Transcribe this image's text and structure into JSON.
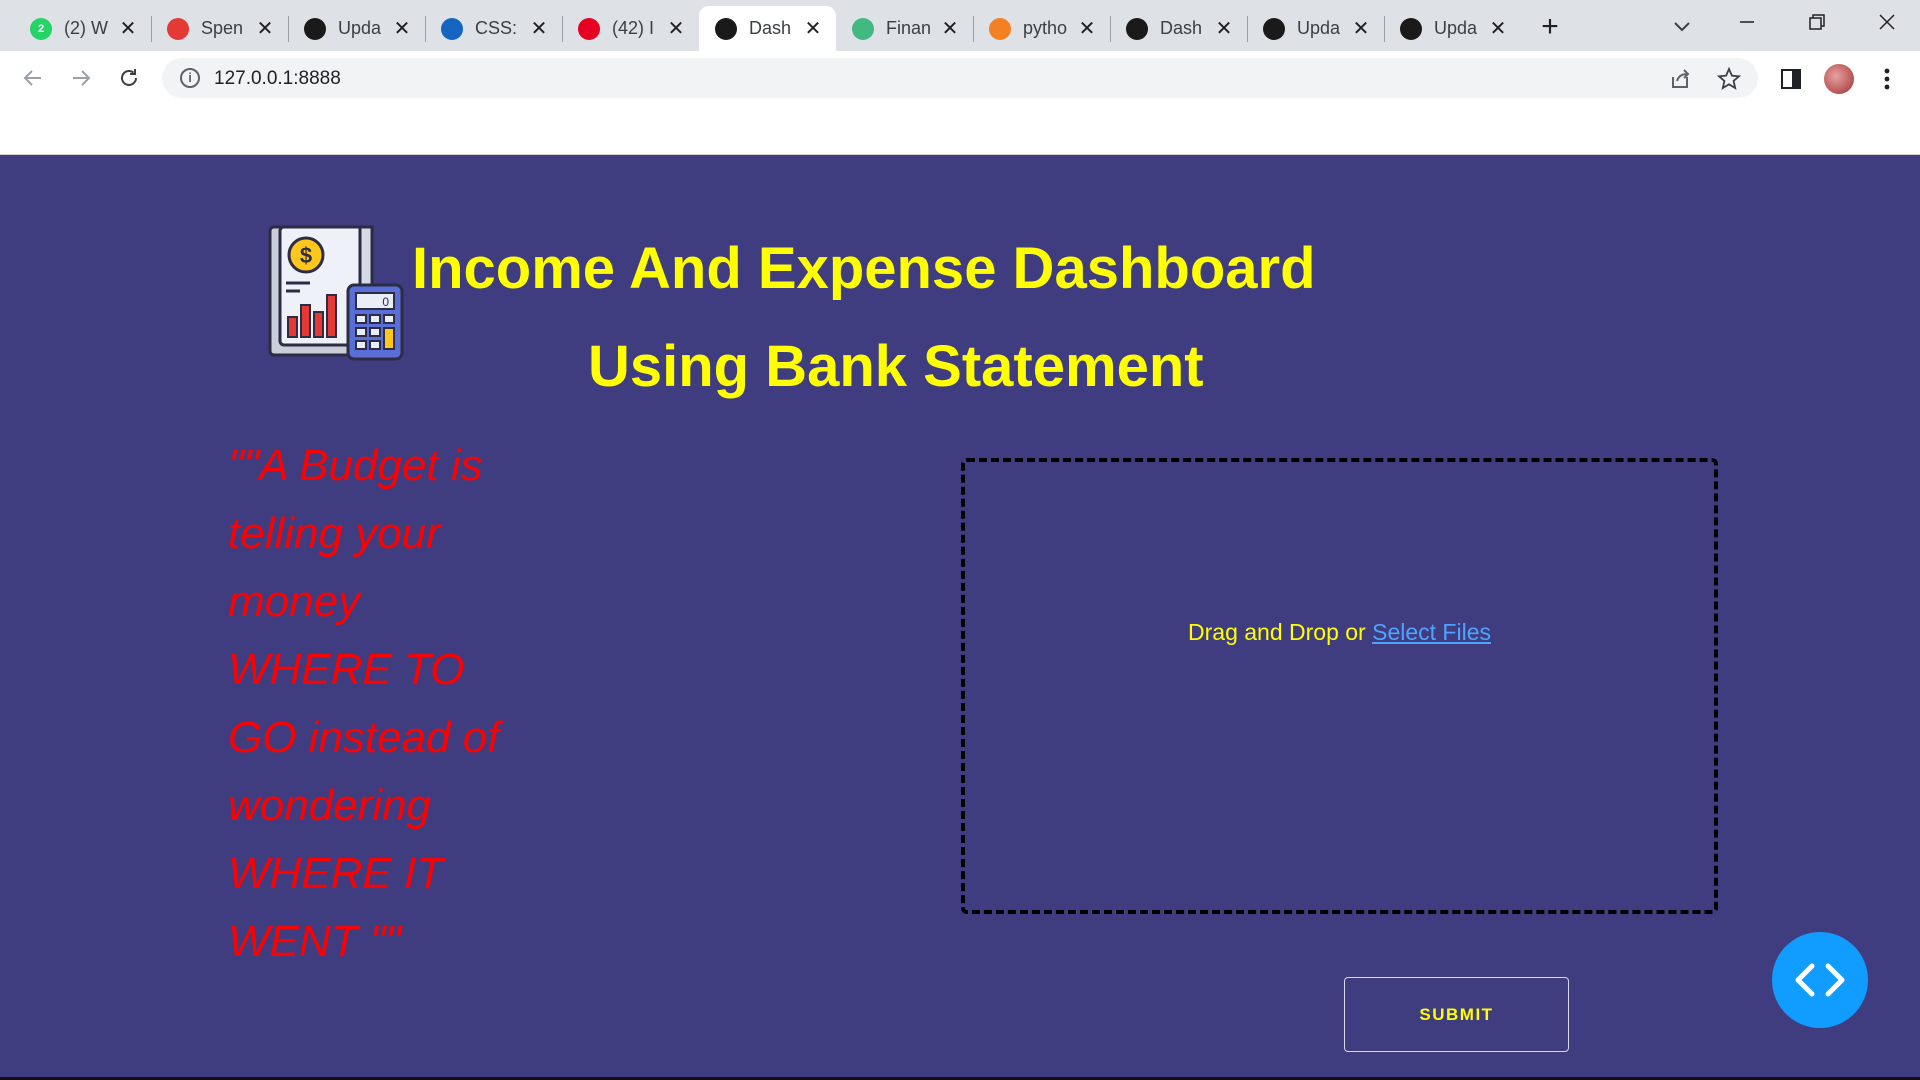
{
  "browser": {
    "tabs": [
      {
        "title": "(2) W",
        "icon": "whatsapp-icon",
        "icon_color": "#25d366",
        "badge": "2"
      },
      {
        "title": "Spen",
        "icon": "pinwheel-icon",
        "icon_color": "#e53935"
      },
      {
        "title": "Upda",
        "icon": "dash-icon",
        "icon_color": "#1a1a1a"
      },
      {
        "title": "CSS:",
        "icon": "w3schools-icon",
        "icon_color": "#1565c0"
      },
      {
        "title": "(42) I",
        "icon": "pinterest-icon",
        "icon_color": "#e60023"
      },
      {
        "title": "Dash",
        "icon": "dash-icon",
        "icon_color": "#1a1a1a",
        "active": true
      },
      {
        "title": "Finan",
        "icon": "vue-icon",
        "icon_color": "#42b883"
      },
      {
        "title": "pytho",
        "icon": "stackoverflow-icon",
        "icon_color": "#f48024"
      },
      {
        "title": "Dash",
        "icon": "dash-icon",
        "icon_color": "#1a1a1a"
      },
      {
        "title": "Upda",
        "icon": "dash-icon",
        "icon_color": "#1a1a1a"
      },
      {
        "title": "Upda",
        "icon": "dash-icon",
        "icon_color": "#1a1a1a"
      }
    ],
    "url": "127.0.0.1:8888"
  },
  "page": {
    "title_line1": "Income And Expense Dashboard",
    "title_line2": "Using Bank Statement",
    "quote_lines": [
      "\"\"A Budget is",
      "telling your",
      "money",
      "WHERE TO",
      "GO instead of",
      "wondering",
      "WHERE IT",
      "WENT \"\""
    ],
    "upload": {
      "text": "Drag and Drop or ",
      "link": "Select Files"
    },
    "submit_label": "SUBMIT"
  },
  "colors": {
    "page_bg": "#3f3d80",
    "title": "#ffff00",
    "quote": "#ff0000",
    "link": "#4ea3ff",
    "fab": "#119dff"
  }
}
